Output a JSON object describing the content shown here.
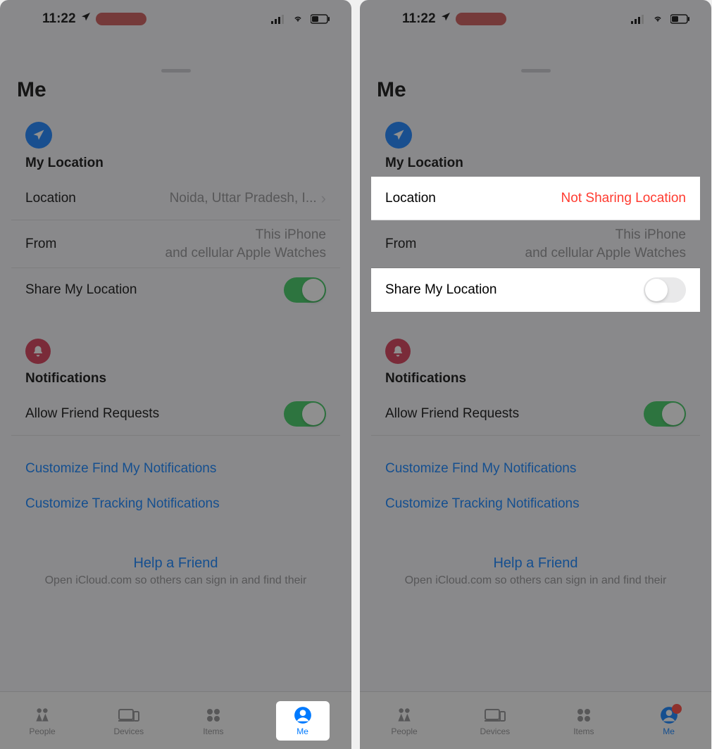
{
  "left": {
    "status": {
      "time": "11:22"
    },
    "sheet_title": "Me",
    "location_section": {
      "title": "My Location",
      "rows": {
        "location_label": "Location",
        "location_value": "Noida, Uttar Pradesh, I...",
        "from_label": "From",
        "from_value1": "This iPhone",
        "from_value2": "and cellular Apple Watches",
        "share_label": "Share My Location",
        "share_on": true
      }
    },
    "notif_section": {
      "title": "Notifications",
      "allow_label": "Allow Friend Requests",
      "allow_on": true,
      "link1": "Customize Find My Notifications",
      "link2": "Customize Tracking Notifications"
    },
    "help": {
      "title": "Help a Friend",
      "sub": "Open iCloud.com so others can sign in and find their"
    },
    "tabs": {
      "people": "People",
      "devices": "Devices",
      "items": "Items",
      "me": "Me"
    }
  },
  "right": {
    "status": {
      "time": "11:22"
    },
    "sheet_title": "Me",
    "location_section": {
      "title": "My Location",
      "rows": {
        "location_label": "Location",
        "location_value": "Not Sharing Location",
        "from_label": "From",
        "from_value1": "This iPhone",
        "from_value2": "and cellular Apple Watches",
        "share_label": "Share My Location",
        "share_on": false
      }
    },
    "notif_section": {
      "title": "Notifications",
      "allow_label": "Allow Friend Requests",
      "allow_on": true,
      "link1": "Customize Find My Notifications",
      "link2": "Customize Tracking Notifications"
    },
    "help": {
      "title": "Help a Friend",
      "sub": "Open iCloud.com so others can sign in and find their"
    },
    "tabs": {
      "people": "People",
      "devices": "Devices",
      "items": "Items",
      "me": "Me"
    }
  }
}
